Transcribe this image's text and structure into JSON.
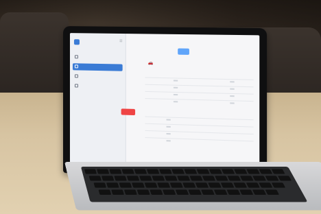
{
  "photo": {
    "subject": "laptop-on-desk",
    "colors": {
      "wall": "#3a2f27",
      "desk": "#d7c4a2",
      "accent": "#3a7bd5",
      "danger": "#ef4444"
    },
    "screen_app": {
      "sidebar": {
        "logo_text": "",
        "items": [
          {
            "icon": "grid-icon",
            "label": ""
          },
          {
            "icon": "edit-icon",
            "label": "",
            "active": true
          },
          {
            "icon": "car-icon",
            "label": ""
          },
          {
            "icon": "receipt-icon",
            "label": ""
          }
        ],
        "logout_label": ""
      },
      "header": {
        "title": ""
      },
      "filter": {
        "label": "",
        "value": ""
      },
      "vehicle": {
        "label": ""
      },
      "sections": [
        {
          "title": "",
          "rows": [
            [
              "",
              "",
              "",
              ""
            ],
            [
              "",
              "",
              "",
              ""
            ],
            [
              "",
              "",
              "",
              ""
            ],
            [
              "",
              "",
              "",
              ""
            ]
          ]
        },
        {
          "title": "",
          "rows": [
            [
              "",
              "",
              "",
              ""
            ],
            [
              "",
              "",
              "",
              ""
            ],
            [
              "",
              "",
              "",
              ""
            ],
            [
              "",
              "",
              "",
              ""
            ]
          ]
        }
      ],
      "footer": {
        "title": ""
      }
    }
  }
}
